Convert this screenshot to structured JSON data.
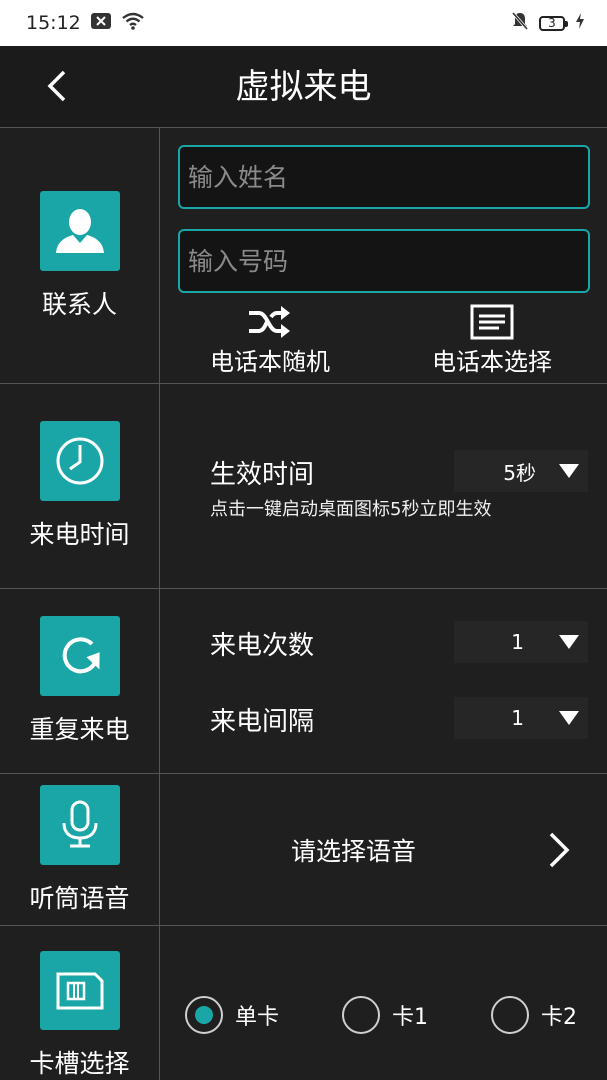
{
  "status_bar": {
    "time": "15:12",
    "battery_level": "3"
  },
  "header": {
    "title": "虚拟来电"
  },
  "sections": {
    "contact": {
      "label": "联系人",
      "name_placeholder": "输入姓名",
      "number_placeholder": "输入号码",
      "random_label": "电话本随机",
      "select_label": "电话本选择"
    },
    "call_time": {
      "label": "来电时间",
      "field_label": "生效时间",
      "value": "5秒",
      "note": "点击一键启动桌面图标5秒立即生效"
    },
    "repeat": {
      "label": "重复来电",
      "count_label": "来电次数",
      "count_value": "1",
      "interval_label": "来电间隔",
      "interval_value": "1"
    },
    "voice": {
      "label": "听筒语音",
      "choose_label": "请选择语音"
    },
    "sim": {
      "label": "卡槽选择",
      "options": [
        "单卡",
        "卡1",
        "卡2"
      ],
      "selected": "单卡"
    }
  },
  "colors": {
    "accent": "#1aa6a6",
    "background": "#1f1f1f",
    "divider": "#555555"
  }
}
